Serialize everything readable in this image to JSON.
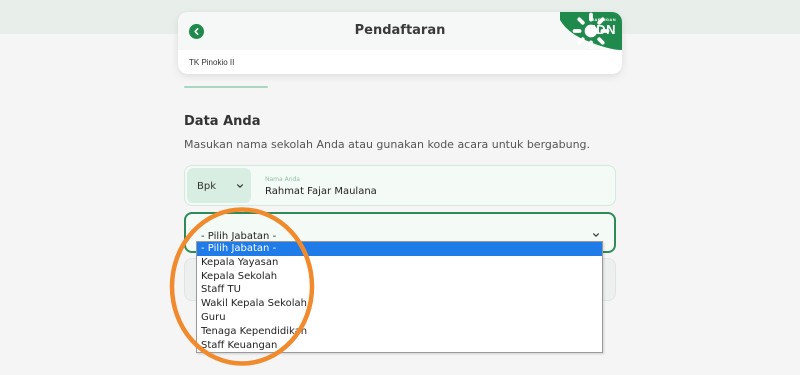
{
  "header": {
    "title": "Pendaftaran",
    "back_icon": "chevron-left-icon",
    "brand": {
      "small_text": "JARINGAN",
      "big_text": "IDN",
      "color": "#1f8a4c"
    },
    "school_name": "TK Pinokio II"
  },
  "form": {
    "section_title": "Data Anda",
    "description": "Masukan nama sekolah Anda atau gunakan kode acara untuk bergabung.",
    "salutation": {
      "value": "Bpk",
      "icon": "chevron-down-icon"
    },
    "name_field": {
      "caption": "Nama Anda",
      "value": "Rahmat Fajar Maulana"
    },
    "jabatan": {
      "value": "- Pilih Jabatan -",
      "icon": "chevron-down-icon",
      "options": [
        "- Pilih Jabatan -",
        "Kepala Yayasan",
        "Kepala Sekolah",
        "Staff TU",
        "Wakil Kepala Sekolah",
        "Guru",
        "Tenaga Kependidikan",
        "Staff Keuangan"
      ],
      "selected_index": 0
    }
  },
  "colors": {
    "accent": "#1f8a4c",
    "select_border": "#2e8b57",
    "highlight": "#1e7be8",
    "annotation": "#f08a2c"
  }
}
